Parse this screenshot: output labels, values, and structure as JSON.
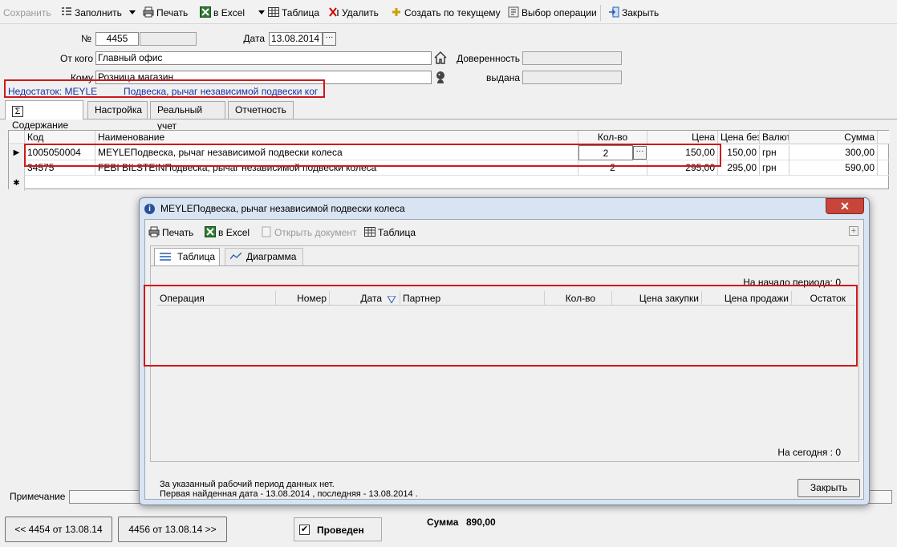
{
  "toolbar": {
    "save": "Сохранить",
    "fill": "Заполнить",
    "print": "Печать",
    "excel": "в Excel",
    "table": "Таблица",
    "delete": "Удалить",
    "create_current": "Создать по текущему",
    "select_operation": "Выбор операции",
    "close": "Закрыть"
  },
  "form": {
    "number_label": "№",
    "number": "4455",
    "date_label": "Дата",
    "date": "13.08.2014",
    "from_label": "От кого",
    "from": "Главный офис",
    "to_label": "Кому",
    "to": "Розница магазин",
    "power_label": "Доверенность",
    "issued_label": "выдана",
    "shortage_label": "Недостаток: MEYLE",
    "shortage_text": "Подвеска, рычаг независимой подвески ког"
  },
  "tabs": [
    "Содержание",
    "Настройка",
    "Реальный учет",
    "Отчетность"
  ],
  "grid": {
    "headers": [
      "Код",
      "Наименование",
      "Кол-во",
      "Цена",
      "Цена без",
      "Валют",
      "Сумма"
    ],
    "rows": [
      {
        "code": "1005050004",
        "name": "MEYLEПодвеска, рычаг независимой подвески колеса",
        "qty": "2",
        "price": "150,00",
        "price_wo": "150,00",
        "currency": "грн",
        "sum": "300,00"
      },
      {
        "code": "34575",
        "name": "FEBI  BILSTEINПодвеска, рычаг независимой подвески колеса",
        "qty": "2",
        "price": "295,00",
        "price_wo": "295,00",
        "currency": "грн",
        "sum": "590,00"
      }
    ],
    "sigma": "Σ",
    "newrow": "✱"
  },
  "dialog": {
    "title": "MEYLEПодвеска, рычаг независимой подвески колеса",
    "close": "✕",
    "print": "Печать",
    "excel": "в Excel",
    "open_doc": "Открыть документ",
    "table": "Таблица",
    "tab_table": "Таблица",
    "tab_chart": "Диаграмма",
    "period_start": "На начало периода:  0",
    "headers": [
      "Операция",
      "Номер",
      "Дата",
      "Партнер",
      "Кол-во",
      "Цена закупки",
      "Цена продажи",
      "Остаток"
    ],
    "today": "На сегодня :  0",
    "msg1": "За указанный рабочий период данных нет.",
    "msg2": "Первая найденная дата - 13.08.2014 , последняя - 13.08.2014 .",
    "close_btn": "Закрыть"
  },
  "footer": {
    "note_label": "Примечание",
    "prev": "<< 4454 от 13.08.14",
    "next": "4456 от 13.08.14 >>",
    "posted": "Проведен",
    "sum_label": "Сумма",
    "sum": "890,00"
  },
  "colors": {
    "highlight": "#d01818",
    "link": "#1a2ea8",
    "dialog_frame": "#d9e4f2"
  }
}
